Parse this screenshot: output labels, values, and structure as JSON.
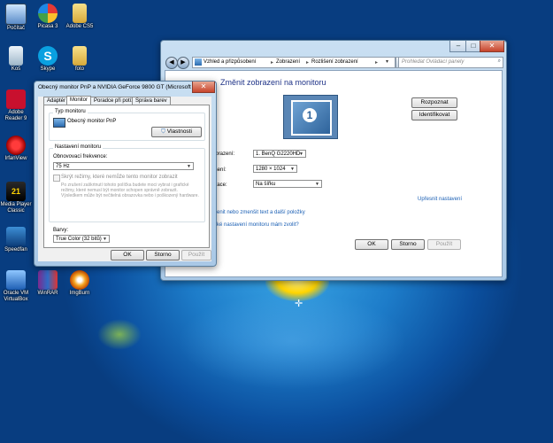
{
  "desktop_icons": [
    {
      "label": "Počítač",
      "icon": "computer-icon"
    },
    {
      "label": "Picasa 3",
      "icon": "picasa-icon"
    },
    {
      "label": "Adobe CS5",
      "icon": "folder-icon"
    },
    {
      "label": "Koš",
      "icon": "recycle-bin-icon"
    },
    {
      "label": "Skype",
      "icon": "skype-icon"
    },
    {
      "label": "foto",
      "icon": "folder-icon"
    },
    {
      "label": "Adobe Reader 9",
      "icon": "adobe-reader-icon"
    },
    {
      "label": "IrfanView",
      "icon": "irfanview-icon"
    },
    {
      "label": "Media Player Classic",
      "icon": "media-player-icon"
    },
    {
      "label": "Speedfan",
      "icon": "speedfan-icon"
    },
    {
      "label": "Oracle VM VirtualBox",
      "icon": "virtualbox-icon"
    },
    {
      "label": "WinRAR",
      "icon": "winrar-icon"
    },
    {
      "label": "ImgBurn",
      "icon": "imgburn-icon"
    }
  ],
  "resolution_window": {
    "breadcrumb": [
      "Vzhled a přizpůsobení",
      "Zobrazení",
      "Rozlišení zobrazení"
    ],
    "search_placeholder": "Prohledat Ovládací panely",
    "heading": "Změnit zobrazení na monitoru",
    "detect_label": "Rozpoznat",
    "identify_label": "Identifikovat",
    "monitor_number": "1",
    "display_label": "zobrazení:",
    "display_value": "1. BenQ G2220HD",
    "resolution_label": "zlišení:",
    "resolution_value": "1280 × 1024",
    "orientation_label": "entace:",
    "orientation_value": "Na šířku",
    "advanced_link": "Upřesnit nastavení",
    "link_text_size": "enit nebo zmenšit text a další položky",
    "link_which_settings": "ké nastavení monitoru mám zvolit?",
    "ok_label": "OK",
    "cancel_label": "Storno",
    "apply_label": "Použít"
  },
  "properties_dialog": {
    "title": "Obecný monitor PnP a NVIDIA GeForce 9800 GT (Microsoft Corp...",
    "tabs": [
      "Adaptér",
      "Monitor",
      "Poradce při potížích",
      "Správa barev"
    ],
    "active_tab": "Monitor",
    "monitor_type_group": "Typ monitoru",
    "monitor_name": "Obecný monitor PnP",
    "properties_button": "Vlastnosti",
    "monitor_settings_group": "Nastavení monitoru",
    "refresh_label": "Obnovovací frekvence:",
    "refresh_value": "75 Hz",
    "hide_modes_label": "Skrýt režimy, které nemůže tento monitor zobrazit",
    "warning_text": [
      "Po zrušení zaškrtnutí tohoto políčka budete moci vybrat i grafické",
      "režimy, které nemusí být monitor schopen správně zobrazit.",
      "Výsledkem může být nečitelná obrazovka nebo i poškozený hardware."
    ],
    "colors_label": "Barvy:",
    "colors_value": "True Color (32 bitů)",
    "ok_label": "OK",
    "cancel_label": "Storno",
    "apply_label": "Použít"
  }
}
